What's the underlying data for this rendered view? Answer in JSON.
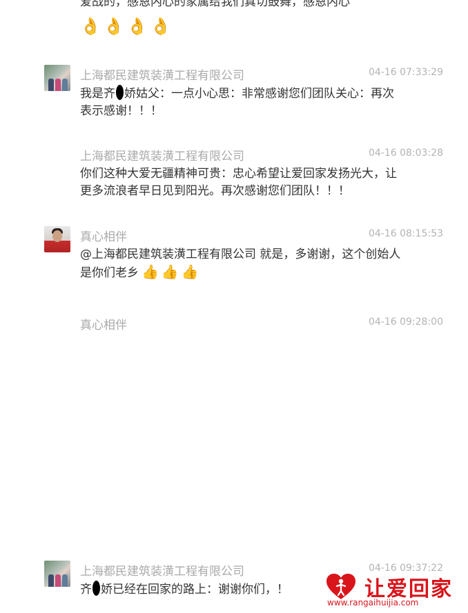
{
  "prev_message": {
    "text_cut": "爱战的，感恩内心的家属给我们真切鼓舞，感恩内心",
    "emoji": "👌"
  },
  "messages": [
    {
      "sender": "上海都民建筑装潢工程有限公司",
      "time": "04-16 07:33:29",
      "line1_a": "我是齐",
      "line1_b": "娇姑父：一点小心思：非常感谢您们团队关心：再次",
      "line2": "表示感谢！！！"
    },
    {
      "sender": "上海都民建筑装潢工程有限公司",
      "time": "04-16 08:03:28",
      "line1": "你们这种大爱无疆精神可贵：忠心希望让爱回家发扬光大，让",
      "line2": "更多流浪者早日见到阳光。再次感谢您们团队！！！"
    },
    {
      "sender": "真心相伴",
      "time": "04-16 08:15:53",
      "line1": "@上海都民建筑装潢工程有限公司 就是，多谢谢，这个创始人",
      "line2": "是你们老乡",
      "thumb": "👍"
    },
    {
      "sender": "真心相伴",
      "time": "04-16 09:28:00"
    },
    {
      "sender": "上海都民建筑装潢工程有限公司",
      "time": "04-16 09:37:22",
      "line1_a": "齐",
      "line1_b": "娇已经在回家的路上：谢谢你们，！"
    }
  ],
  "logo": {
    "name": "让爱回家",
    "url": "www.rangaihuijia.com",
    "color": "#d9141b"
  }
}
